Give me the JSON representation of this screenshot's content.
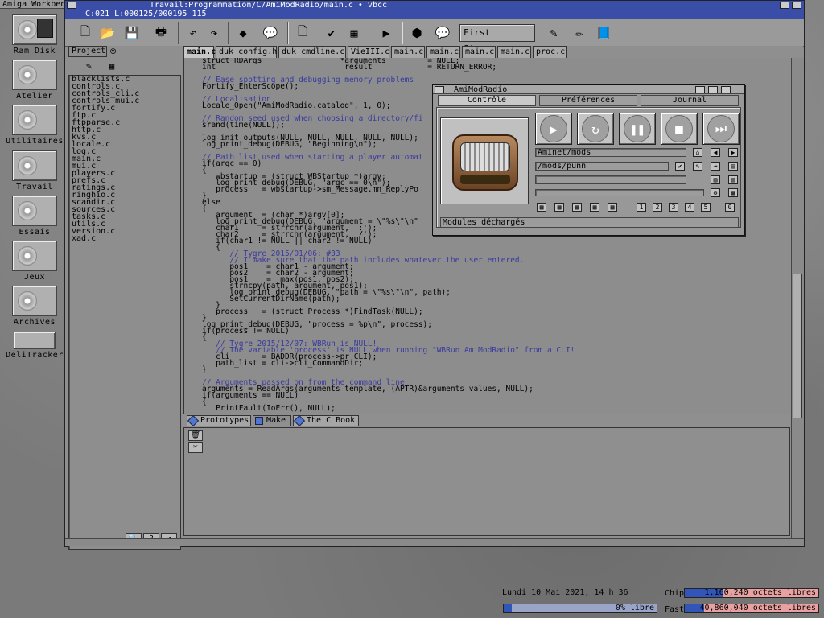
{
  "workbench": {
    "title": "Amiga Workbench",
    "icons": [
      "Ram Disk",
      "Atelier",
      "Utilitaires",
      "Travail",
      "Essais",
      "Jeux",
      "Archives",
      "DeliTracker"
    ]
  },
  "main_window": {
    "title": "Travail:Programmation/C/AmiModRadio/main.c • vbcc",
    "status": "C:021 L:000125/000195 115",
    "toolbar": {
      "first_steps": "First Steps..."
    },
    "project_tab": "Project",
    "files": [
      "blacklists.c",
      "controls.c",
      "controls_cli.c",
      "controls_mui.c",
      "fortify.c",
      "ftp.c",
      "ftpparse.c",
      "http.c",
      "kvs.c",
      "locale.c",
      "log.c",
      "main.c",
      "mui.c",
      "players.c",
      "prefs.c",
      "ratings.c",
      "ringhio.c",
      "scandir.c",
      "sources.c",
      "tasks.c",
      "utils.c",
      "version.c",
      "xad.c"
    ],
    "editor_tabs": [
      "main.c",
      "duk_config.h",
      "duk_cmdline.c",
      "VieIII.c",
      "main.c",
      "main.c",
      "main.c",
      "main.c",
      "proc.c"
    ],
    "code": [
      "struct RDArgs                 *arguments         = NULL;",
      "int                            result            = RETURN_ERROR;",
      "",
      "// Ease spotting and debugging memory problems",
      "Fortify_EnterScope();",
      "",
      "// Localisation",
      "Locale_Open(\"AmiModRadio.catalog\", 1, 0);",
      "",
      "// Random seed used when choosing a directory/fi",
      "srand(time(NULL));",
      "",
      "log_init_outputs(NULL, NULL, NULL, NULL, NULL);",
      "log_print_debug(DEBUG, \"Beginning\\n\");",
      "",
      "// Path list used when starting a player automat",
      "if(argc == 0)",
      "{",
      "   wbstartup = (struct WBStartup *)argv;",
      "   log_print_debug(DEBUG, \"argc == 0\\n\");",
      "   process   = wbstartup->sm_Message.mn_ReplyPo",
      "}",
      "else",
      "{",
      "   argument  = (char *)argv[0];",
      "   log_print_debug(DEBUG, \"argument = \\\"%s\\\"\\n\"",
      "   char1     = strrchr(argument, ':');",
      "   char2     = strrchr(argument, '/');",
      "   if(char1 != NULL || char2 != NULL)",
      "   {",
      "      // Tygre 2015/01/06: #33",
      "      // I make sure that the path includes whatever the user entered.",
      "      pos1    = char1 - argument;",
      "      pos2    = char2 - argument;",
      "      pos1    = _max(pos1, pos2);",
      "      strncpy(path, argument, pos1);",
      "      log_print_debug(DEBUG, \"path = \\\"%s\\\"\\n\", path);",
      "      SetCurrentDirName(path);",
      "   }",
      "   process   = (struct Process *)FindTask(NULL);",
      "}",
      "log_print_debug(DEBUG, \"process = %p\\n\", process);",
      "if(process != NULL)",
      "{",
      "   // Tygre 2015/12/07: WBRun is NULL!",
      "   // The variable 'process' is NULL when running \"WBRun AmiModRadio\" from a CLI!",
      "   cli       = BADDR(process->pr_CLI);",
      "   path_list = cli->cli_CommandDir;",
      "}",
      "",
      "// Arguments passed on from the command line",
      "arguments = ReadArgs(arguments_template, (APTR)&arguments_values, NULL);",
      "if(arguments == NULL)",
      "{",
      "   PrintFault(IoErr(), NULL);"
    ],
    "bottom_tabs": [
      "Prototypes",
      "Make",
      "The C Book"
    ]
  },
  "amimodradio": {
    "title": "AmiModRadio",
    "tabs": [
      "Contrôle",
      "Préférences",
      "Journal"
    ],
    "source_path": "Aminet/mods",
    "dir_path": "/mods/punn",
    "status": "Modules déchargés",
    "ratings": [
      "1",
      "2",
      "3",
      "4",
      "5",
      "0"
    ]
  },
  "footer": {
    "datetime": "Lundi 10 Mai 2021, 14 h 36",
    "disk_free": "0% libre",
    "chip_label": "Chip",
    "chip_value": "1,160,240 octets libres",
    "fast_label": "Fast",
    "fast_value": "40,860,040 octets libres"
  }
}
